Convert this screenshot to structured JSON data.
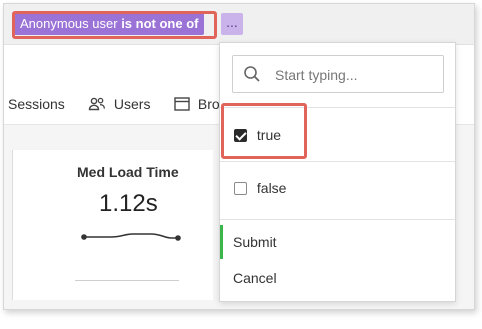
{
  "filter": {
    "subject": "Anonymous user",
    "operator": "is not one of",
    "more_label": "..."
  },
  "tabs": [
    {
      "label": "Sessions"
    },
    {
      "label": "Users",
      "icon": "users-icon"
    },
    {
      "label": "Bro",
      "icon": "browser-icon"
    }
  ],
  "card": {
    "title": "Med Load Time",
    "value": "1.12s"
  },
  "dropdown": {
    "search_placeholder": "Start typing...",
    "search_value": "",
    "options": [
      {
        "label": "true",
        "checked": true
      },
      {
        "label": "false",
        "checked": false
      }
    ],
    "submit_label": "Submit",
    "cancel_label": "Cancel"
  },
  "colors": {
    "pill": "#9b72d6",
    "highlight": "#e0645a",
    "submit_accent": "#3cb54a"
  }
}
